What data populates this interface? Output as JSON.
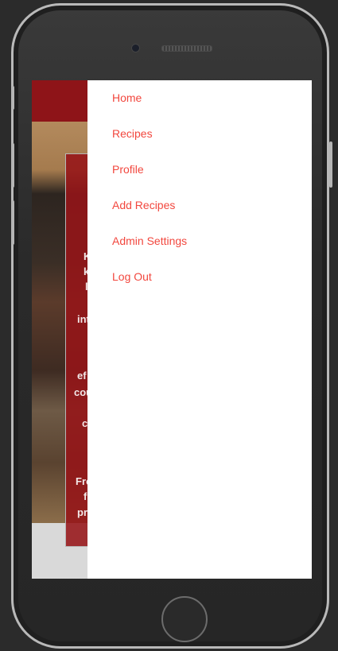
{
  "menu": {
    "items": [
      {
        "label": "Home"
      },
      {
        "label": "Recipes"
      },
      {
        "label": "Profile"
      },
      {
        "label": "Add Recipes"
      },
      {
        "label": "Admin Settings"
      },
      {
        "label": "Log Out"
      }
    ]
  },
  "background_card": {
    "lines": [
      "K",
      "k",
      "l",
      "int",
      "ef",
      "cou",
      "c",
      "Fro",
      "f",
      "pr"
    ]
  },
  "colors": {
    "menu_text": "#f2473e",
    "header": "#8e1418",
    "drawer": "#ffffff"
  }
}
